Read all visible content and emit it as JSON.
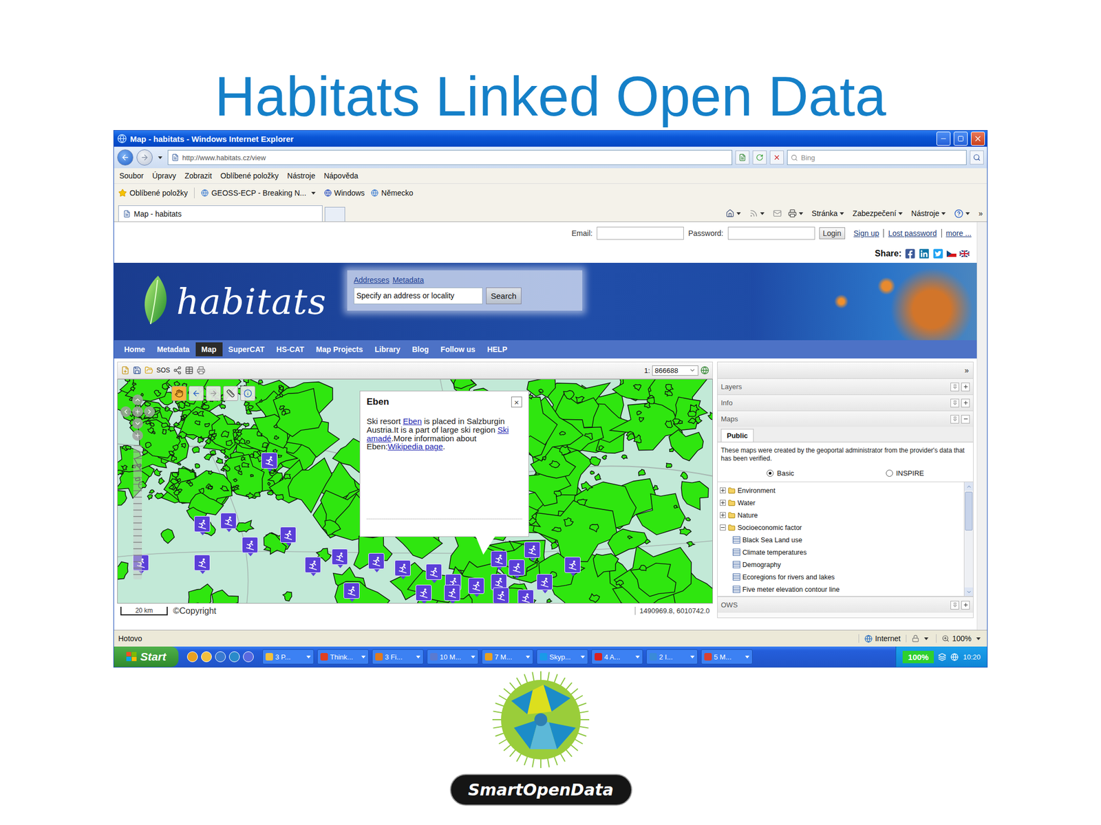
{
  "slide": {
    "title": "Habitats Linked Open Data",
    "logo": "SmartOpenData"
  },
  "window": {
    "title": "Map - habitats - Windows Internet Explorer",
    "address": "http://www.habitats.cz/view",
    "search_placeholder": "Bing"
  },
  "menu": [
    "Soubor",
    "Úpravy",
    "Zobrazit",
    "Oblíbené položky",
    "Nástroje",
    "Nápověda"
  ],
  "favorites": {
    "label": "Oblíbené položky",
    "items": [
      "GEOSS-ECP - Breaking N...",
      "Windows",
      "Německo"
    ]
  },
  "tabs": [
    {
      "label": "Map - habitats",
      "selected": true
    }
  ],
  "command_bar": {
    "items": [
      "Stránka",
      "Zabezpečení",
      "Nástroje"
    ],
    "overflow": "»"
  },
  "login": {
    "email_label": "Email:",
    "password_label": "Password:",
    "button": "Login",
    "links": [
      "Sign up",
      "Lost password",
      "more ..."
    ]
  },
  "share": {
    "label": "Share:"
  },
  "site": {
    "name": "habitats",
    "search_tabs": [
      "Addresses",
      "Metadata"
    ],
    "search_value": "Specify an address or locality",
    "search_button": "Search"
  },
  "nav": [
    {
      "label": "Home",
      "selected": false
    },
    {
      "label": "Metadata",
      "selected": false
    },
    {
      "label": "Map",
      "selected": true
    },
    {
      "label": "SuperCAT",
      "selected": false
    },
    {
      "label": "HS-CAT",
      "selected": false
    },
    {
      "label": "Map Projects",
      "selected": false
    },
    {
      "label": "Library",
      "selected": false
    },
    {
      "label": "Blog",
      "selected": false
    },
    {
      "label": "Follow us",
      "selected": false
    },
    {
      "label": "HELP",
      "selected": false
    }
  ],
  "map_toolbar": {
    "tool_label": "SOS",
    "scale_prefix": "1:",
    "scale": "866688"
  },
  "popup": {
    "title": "Eben",
    "close": "×",
    "body": [
      {
        "text": "Ski resort ",
        "kind": "text"
      },
      {
        "text": "Eben",
        "kind": "link"
      },
      {
        "text": " is placed in Salzburgin Austria.It is a part of large ski region ",
        "kind": "text"
      },
      {
        "text": "Ski amadé",
        "kind": "link"
      },
      {
        "text": ".More information about Eben:",
        "kind": "text"
      },
      {
        "text": "Wikipedia page",
        "kind": "link"
      },
      {
        "text": ".",
        "kind": "text"
      }
    ]
  },
  "map_footer": {
    "scale_bar": "20 km",
    "copyright": "©Copyright",
    "coordinates": "1490969.8, 6010742.0"
  },
  "panel": {
    "collapse": "»",
    "sections": [
      {
        "label": "Layers",
        "expanded": false
      },
      {
        "label": "Info",
        "expanded": false
      },
      {
        "label": "Maps",
        "expanded": true
      }
    ],
    "tabs": [
      {
        "label": "Public",
        "selected": true
      }
    ],
    "description": "These maps were created by the geoportal administrator from the provider's data that has been verified.",
    "radios": [
      {
        "label": "Basic",
        "selected": true
      },
      {
        "label": "INSPIRE",
        "selected": false
      }
    ],
    "tree": [
      {
        "label": "Environment",
        "expanded": false,
        "children": []
      },
      {
        "label": "Water",
        "expanded": false,
        "children": []
      },
      {
        "label": "Nature",
        "expanded": false,
        "children": []
      },
      {
        "label": "Socioeconomic factor",
        "expanded": true,
        "children": [
          "Black Sea Land use",
          "Climate temperatures",
          "Demography",
          "Ecoregions for rivers and lakes",
          "Five meter elevation contour line"
        ]
      }
    ],
    "footer": {
      "label": "OWS",
      "expanded": false
    }
  },
  "status_bar": {
    "text": "Hotovo",
    "zone": "Internet",
    "zoom": "100%"
  },
  "taskbar": {
    "start": "Start",
    "tasks": [
      "3 P...",
      "Think...",
      "3 Fi...",
      "10 M...",
      "7 M...",
      "Skyp...",
      "4 A...",
      "2 I...",
      "5 M..."
    ],
    "battery": "100%",
    "clock": "10:20"
  }
}
